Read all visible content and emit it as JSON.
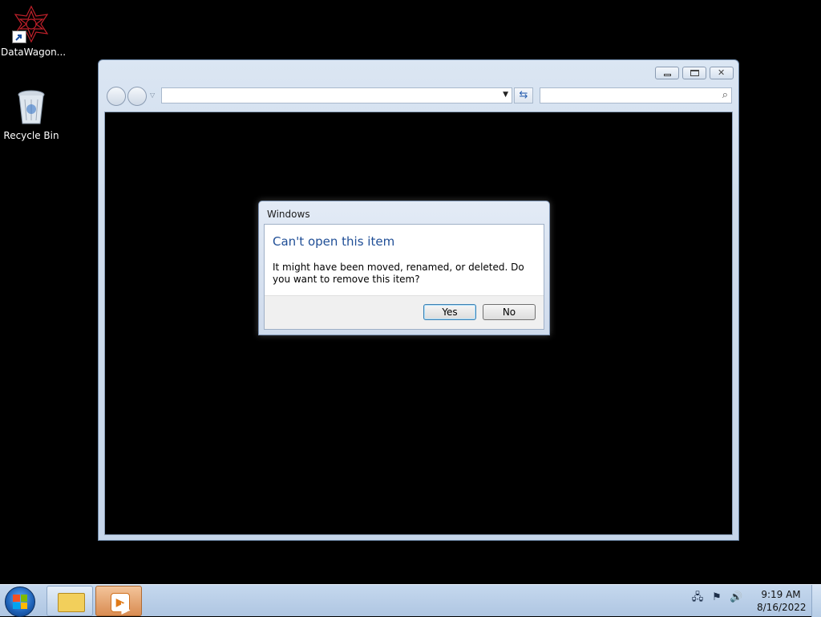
{
  "desktop": {
    "icons": [
      {
        "label": "DataWagon..."
      },
      {
        "label": "Recycle Bin"
      }
    ]
  },
  "explorer": {
    "address_value": "",
    "search_placeholder": ""
  },
  "dialog": {
    "title": "Windows",
    "heading": "Can't open this item",
    "message": "It might have been moved, renamed, or deleted. Do you want to remove this item?",
    "yes_label": "Yes",
    "no_label": "No"
  },
  "taskbar": {
    "time": "9:19 AM",
    "date": "8/16/2022"
  },
  "colors": {
    "desktop_bg": "#000000",
    "dialog_heading": "#1f4e96",
    "taskbar": "#b9cfe8"
  }
}
